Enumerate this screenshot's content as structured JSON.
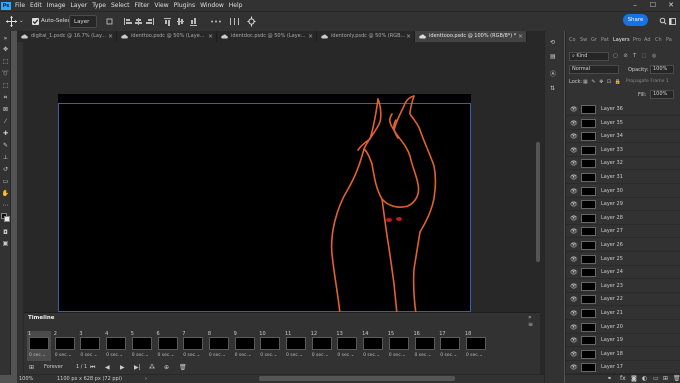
{
  "app_logo": "Ps",
  "menu": [
    "File",
    "Edit",
    "Image",
    "Layer",
    "Type",
    "Select",
    "Filter",
    "View",
    "Plugins",
    "Window",
    "Help"
  ],
  "window_controls": {
    "minimize": "–",
    "maximize": "☐",
    "close": "✕"
  },
  "options": {
    "auto_select_label": "Auto-Select:",
    "auto_select_checked": true,
    "auto_select_value": "Layer",
    "share_label": "Share"
  },
  "tabs": [
    {
      "label": "digital_1.psdc @ 16.7% (Lay...",
      "active": false
    },
    {
      "label": "identtoo.psdc @ 50% (Laye...",
      "active": false
    },
    {
      "label": "identdoc.psdc @ 50% (Laye...",
      "active": false
    },
    {
      "label": "identonly.psdc @ 50% (RGB...",
      "active": false
    },
    {
      "label": "identtooo.psdc @ 100% (RGB/8*) *",
      "active": true
    }
  ],
  "timeline": {
    "title": "Timeline",
    "frames": [
      {
        "num": "1",
        "duration": "0 sec.⌄",
        "selected": true
      },
      {
        "num": "2",
        "duration": "0 sec.⌄"
      },
      {
        "num": "3",
        "duration": "0 sec.⌄"
      },
      {
        "num": "4",
        "duration": "0 sec.⌄"
      },
      {
        "num": "5",
        "duration": "0 sec.⌄"
      },
      {
        "num": "6",
        "duration": "0 sec.⌄"
      },
      {
        "num": "7",
        "duration": "0 sec.⌄"
      },
      {
        "num": "8",
        "duration": "0 sec.⌄"
      },
      {
        "num": "9",
        "duration": "0 sec.⌄"
      },
      {
        "num": "10",
        "duration": "0 sec.⌄"
      },
      {
        "num": "11",
        "duration": "0 sec.⌄"
      },
      {
        "num": "12",
        "duration": "0 sec.⌄"
      },
      {
        "num": "13",
        "duration": "0 sec.⌄"
      },
      {
        "num": "14",
        "duration": "0 sec.⌄"
      },
      {
        "num": "15",
        "duration": "0 sec.⌄"
      },
      {
        "num": "16",
        "duration": "0 sec.⌄"
      },
      {
        "num": "17",
        "duration": "0 sec.⌄"
      },
      {
        "num": "18",
        "duration": "0 sec.⌄"
      }
    ],
    "loop_label": "Forever",
    "status_text": "1 / 1"
  },
  "status": {
    "zoom": "100%",
    "doc_size": "1100 px x 628 px (72 ppi)"
  },
  "panel_tabs": [
    "Co",
    "Sw",
    "Gr",
    "Pat",
    "Layers",
    "Pro",
    "Ad",
    "Ch",
    "Pa"
  ],
  "layers_panel": {
    "kind_label": "Kind",
    "blend_mode": "Normal",
    "opacity_label": "Opacity:",
    "opacity_value": "100%",
    "lock_label": "Lock:",
    "propagate_label": "Propagate Frame 1",
    "fill_label": "Fill:",
    "fill_value": "100%",
    "layers": [
      "Layer 36",
      "Layer 35",
      "Layer 34",
      "Layer 33",
      "Layer 32",
      "Layer 31",
      "Layer 30",
      "Layer 29",
      "Layer 28",
      "Layer 27",
      "Layer 26",
      "Layer 25",
      "Layer 24",
      "Layer 23",
      "Layer 22",
      "Layer 21",
      "Layer 20",
      "Layer 19",
      "Layer 18",
      "Layer 17"
    ]
  },
  "colors": {
    "accent": "#1473e6",
    "stroke": "#e0622c",
    "eyes": "#c4191b"
  }
}
